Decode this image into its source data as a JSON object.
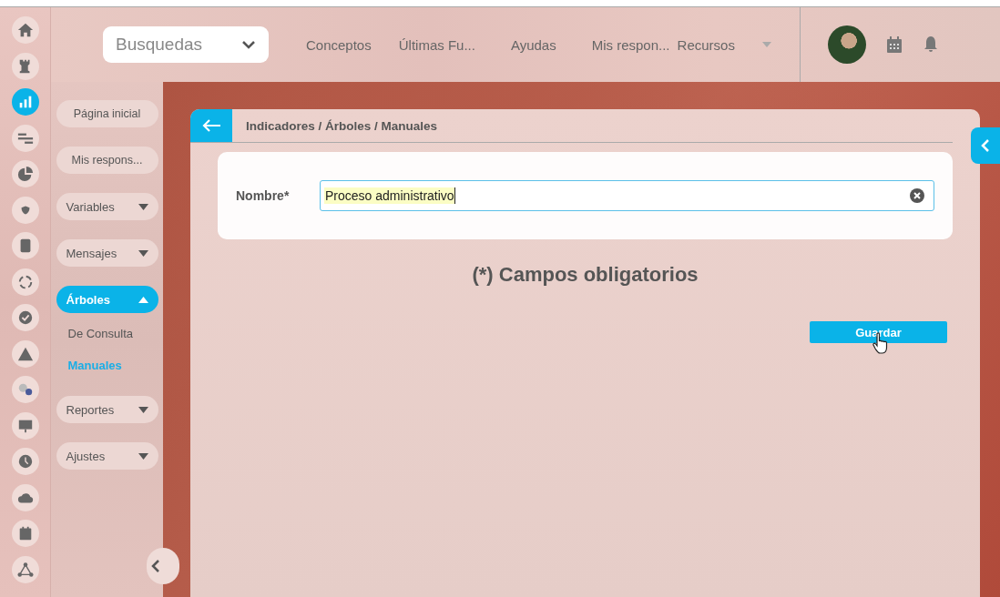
{
  "rail": [
    {
      "selected": false
    },
    {
      "selected": false
    },
    {
      "selected": true
    },
    {
      "selected": false
    },
    {
      "selected": false
    },
    {
      "selected": false
    },
    {
      "selected": false
    },
    {
      "selected": false
    },
    {
      "selected": false
    },
    {
      "selected": false
    },
    {
      "selected": false
    },
    {
      "selected": false
    },
    {
      "selected": false
    },
    {
      "selected": false
    },
    {
      "selected": false
    },
    {
      "selected": false
    }
  ],
  "topbar": {
    "search": {
      "value": "Busquedas"
    },
    "links": [
      {
        "label": "Conceptos"
      },
      {
        "label": "Últimas Fu..."
      },
      {
        "label": "Ayudas"
      },
      {
        "label": "Mis respon..."
      },
      {
        "label": "Recursos"
      }
    ]
  },
  "sidebar": {
    "items": [
      {
        "kind": "link",
        "label": "Página inicial",
        "selected": false
      },
      {
        "kind": "link",
        "label": "Mis respons...",
        "selected": false
      },
      {
        "kind": "menu",
        "label": "Variables",
        "selected": false,
        "expanded": false
      },
      {
        "kind": "menu",
        "label": "Mensajes",
        "selected": false,
        "expanded": false
      },
      {
        "kind": "menu",
        "label": "Árboles",
        "selected": true,
        "expanded": true,
        "children": [
          {
            "label": "De Consulta",
            "selected": false
          },
          {
            "label": "Manuales",
            "selected": true
          }
        ]
      },
      {
        "kind": "menu",
        "label": "Reportes",
        "selected": false,
        "expanded": false
      },
      {
        "kind": "menu",
        "label": "Ajustes",
        "selected": false,
        "expanded": false
      }
    ]
  },
  "breadcrumb": "Indicadores / Árboles / Manuales",
  "form": {
    "fields": [
      {
        "label": "Nombre*",
        "value": "Proceso administrativo"
      }
    ],
    "note": "(*) Campos obligatorios",
    "save_button": "Guardar"
  }
}
